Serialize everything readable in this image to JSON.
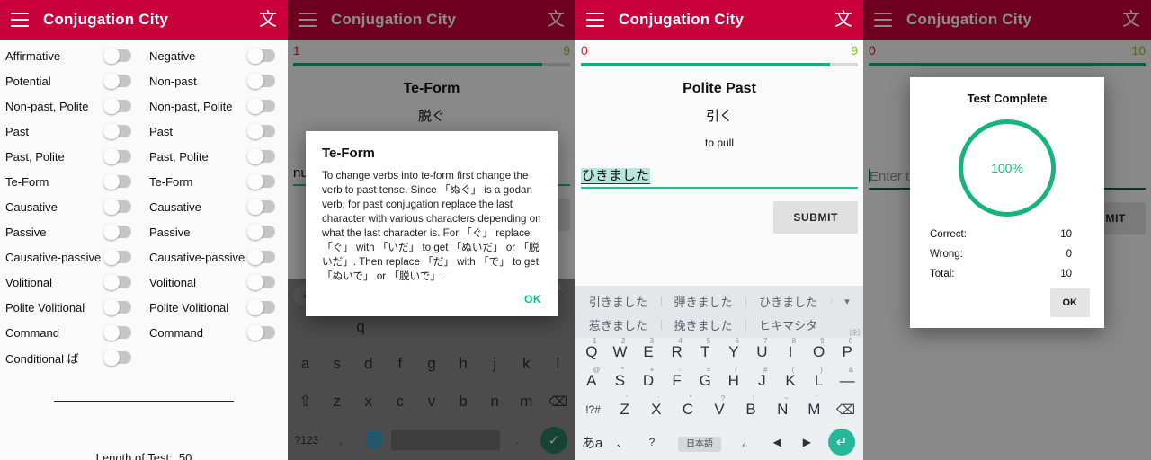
{
  "app": {
    "title": "Conjugation City",
    "menu_icon": "hamburger-menu-icon",
    "lang_icon": "文",
    "brand_color": "#c8003c"
  },
  "panels": [
    {
      "id": "settings",
      "dimmed": false,
      "settings": {
        "left_column_header": "Affirmative",
        "right_column_header": "Negative",
        "rows": [
          {
            "left": "Affirmative",
            "right": "Negative"
          },
          {
            "left": "Potential",
            "right": "Non-past"
          },
          {
            "left": "Non-past, Polite",
            "right": "Non-past, Polite"
          },
          {
            "left": "Past",
            "right": "Past"
          },
          {
            "left": "Past, Polite",
            "right": "Past, Polite"
          },
          {
            "left": "Te-Form",
            "right": "Te-Form"
          },
          {
            "left": "Causative",
            "right": "Causative"
          },
          {
            "left": "Passive",
            "right": "Passive"
          },
          {
            "left": "Causative-passive",
            "right": "Causative-passive"
          },
          {
            "left": "Volitional",
            "right": "Volitional"
          },
          {
            "left": "Polite Volitional",
            "right": "Polite Volitional"
          },
          {
            "left": "Command",
            "right": "Command"
          },
          {
            "left": "Conditional ば",
            "right": ""
          }
        ],
        "test_length_label": "Length of Test:",
        "test_length_value": "50"
      }
    },
    {
      "id": "te-form-hint",
      "dimmed": true,
      "quiz": {
        "wrong": "1",
        "correct": "9",
        "progress_percent": 90,
        "prompt_type": "Te-Form",
        "prompt_verb": "脱ぐ",
        "prompt_meaning": "",
        "answer_text": "nu",
        "submit_label": "SUBMIT"
      },
      "dialog": {
        "title": "Te-Form",
        "body": "To change verbs into te-form first change the verb to past tense. Since 「ぬぐ」 is a godan verb, for past conjugation replace the last character with various characters depending on what the last character is. For 「ぐ」 replace 「ぐ」 with 「いだ」 to get 「ぬいだ」 or 「脱いだ」. Then replace 「だ」 with 「で」 to get 「ぬいで」 or 「脱いで」.",
        "ok_label": "OK"
      }
    },
    {
      "id": "polite-past-input",
      "dimmed": false,
      "quiz": {
        "wrong": "0",
        "correct": "9",
        "progress_percent": 90,
        "prompt_type": "Polite Past",
        "prompt_verb": "引く",
        "prompt_meaning": "to pull",
        "answer_text": "ひきました",
        "submit_label": "SUBMIT"
      },
      "keyboard": {
        "suggestions_row1": [
          "引きました",
          "弾きました",
          "ひきました"
        ],
        "expand_icon": "chevron-down-icon",
        "suggestions_row2": [
          "惹きました",
          "挽きました",
          "ヒキマシタ"
        ],
        "zen_label": "[全]",
        "row1": [
          {
            "k": "Q",
            "n": "1"
          },
          {
            "k": "W",
            "n": "2"
          },
          {
            "k": "E",
            "n": "3"
          },
          {
            "k": "R",
            "n": "4"
          },
          {
            "k": "T",
            "n": "5"
          },
          {
            "k": "Y",
            "n": "6"
          },
          {
            "k": "U",
            "n": "7"
          },
          {
            "k": "I",
            "n": "8"
          },
          {
            "k": "O",
            "n": "9"
          },
          {
            "k": "P",
            "n": "0"
          }
        ],
        "row2": [
          {
            "k": "A",
            "n": "@"
          },
          {
            "k": "S",
            "n": "*"
          },
          {
            "k": "D",
            "n": "+"
          },
          {
            "k": "F",
            "n": "-"
          },
          {
            "k": "G",
            "n": "="
          },
          {
            "k": "H",
            "n": "/"
          },
          {
            "k": "J",
            "n": "#"
          },
          {
            "k": "K",
            "n": "("
          },
          {
            "k": "L",
            "n": ")"
          },
          {
            "k": "—",
            "n": "&"
          }
        ],
        "row3_symbol": "!?#",
        "row3": [
          {
            "k": "Z",
            "n": "'"
          },
          {
            "k": "X",
            "n": ":"
          },
          {
            "k": "C",
            "n": "\""
          },
          {
            "k": "V",
            "n": "?"
          },
          {
            "k": "B",
            "n": "!"
          },
          {
            "k": "N",
            "n": "~"
          },
          {
            "k": "M",
            "n": "¨"
          }
        ],
        "backspace_icon": "backspace-icon",
        "row4": {
          "mode": "あa",
          "comma": "、",
          "question": "?",
          "lang_key": "日本語",
          "period": "。",
          "left_arrow": "◀",
          "right_arrow": "▶",
          "enter_icon": "enter-icon"
        }
      }
    },
    {
      "id": "test-complete",
      "dimmed": true,
      "quiz": {
        "wrong": "0",
        "correct": "10",
        "progress_percent": 100,
        "prompt_type": "",
        "prompt_verb": "",
        "prompt_meaning": "",
        "answer_placeholder": "Enter th",
        "submit_label": "MIT"
      },
      "dialog": {
        "title": "Test Complete",
        "percent": "100%",
        "stats": [
          {
            "label": "Correct:",
            "value": "10"
          },
          {
            "label": "Wrong:",
            "value": "0"
          },
          {
            "label": "Total:",
            "value": "10"
          }
        ],
        "ok_label": "OK"
      }
    }
  ],
  "qwerty_grey": {
    "row_home": [
      "a",
      "s",
      "d",
      "f",
      "g",
      "h",
      "j",
      "k",
      "l"
    ],
    "shift_icon": "shift-icon",
    "row_bottom": [
      "z",
      "x",
      "c",
      "v",
      "b",
      "n",
      "m"
    ],
    "backspace_icon": "backspace-icon",
    "symbol_key": "?123",
    "emoji_key": ",",
    "globe_icon": "globe-icon",
    "period_key": ".",
    "check_icon": "check-icon",
    "partial_text_left": "nu",
    "partial_text_right": "N",
    "mic_icon": "microphone-icon",
    "chevron_right_icon": "chevron-right-icon"
  }
}
